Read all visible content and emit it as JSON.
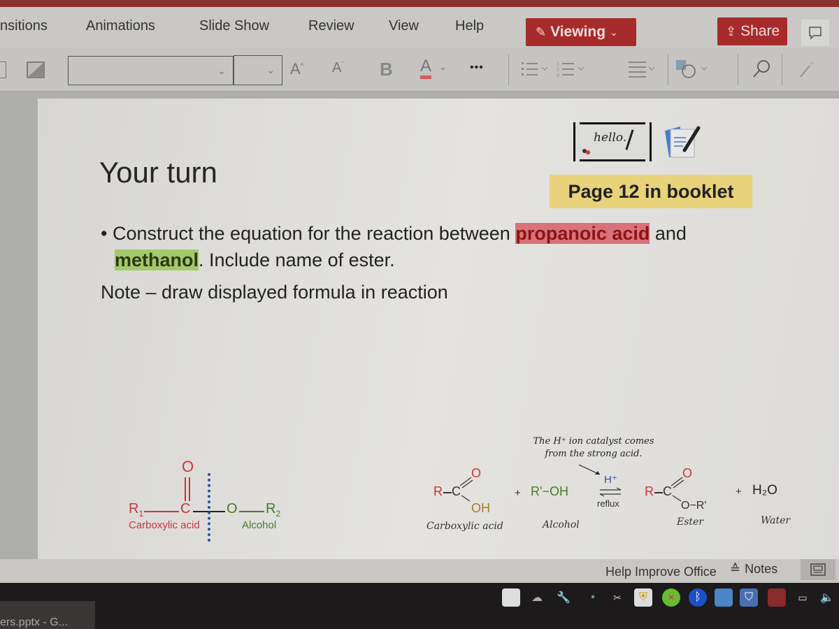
{
  "app": {
    "ribbon_tabs": [
      "nsitions",
      "Animations",
      "Slide Show",
      "Review",
      "View",
      "Help"
    ],
    "viewing_label": "Viewing",
    "share_label": "Share",
    "font_name_value": "",
    "font_size_value": "",
    "toolbar": {
      "grow_font": "A",
      "shrink_font": "A",
      "bold": "B",
      "font_color": "A",
      "more": "•••"
    },
    "accent_color": "#a82b2b"
  },
  "slide": {
    "title": "Your turn",
    "booklet_note": "Page 12 in booklet",
    "hello_image_text": "hello.",
    "bullet": {
      "prefix": "Construct the equation for the reaction between ",
      "highlight1": "propanoic acid",
      "middle": " and ",
      "highlight2": "methanol",
      "suffix": ". Include name of ester."
    },
    "note": "Note – draw displayed formula in reaction",
    "diagram_left": {
      "R1": "R",
      "R1_sub": "1",
      "C": "C",
      "O_double": "O",
      "O_single": "O",
      "R2": "R",
      "R2_sub": "2",
      "label_acid": "Carboxylic acid",
      "label_alcohol": "Alcohol"
    },
    "diagram_right": {
      "catalyst_note_line1": "The H⁺ ion catalyst comes",
      "catalyst_note_line2": "from the strong acid.",
      "acid_R": "R",
      "acid_C": "C",
      "acid_O": "O",
      "acid_OH": "OH",
      "plus1": "+",
      "alcohol": "R'−OH",
      "catalyst": "H⁺",
      "condition": "reflux",
      "ester_R": "R",
      "ester_C": "C",
      "ester_O": "O",
      "ester_OR": "O−R'",
      "plus2": "+",
      "water": "H₂O",
      "label_acid": "Carboxylic acid",
      "label_alcohol": "Alcohol",
      "label_ester": "Ester",
      "label_water": "Water"
    }
  },
  "statusbar": {
    "help_improve": "Help Improve Office",
    "notes": "Notes"
  },
  "taskbar": {
    "active_item": "ers.pptx - G..."
  }
}
